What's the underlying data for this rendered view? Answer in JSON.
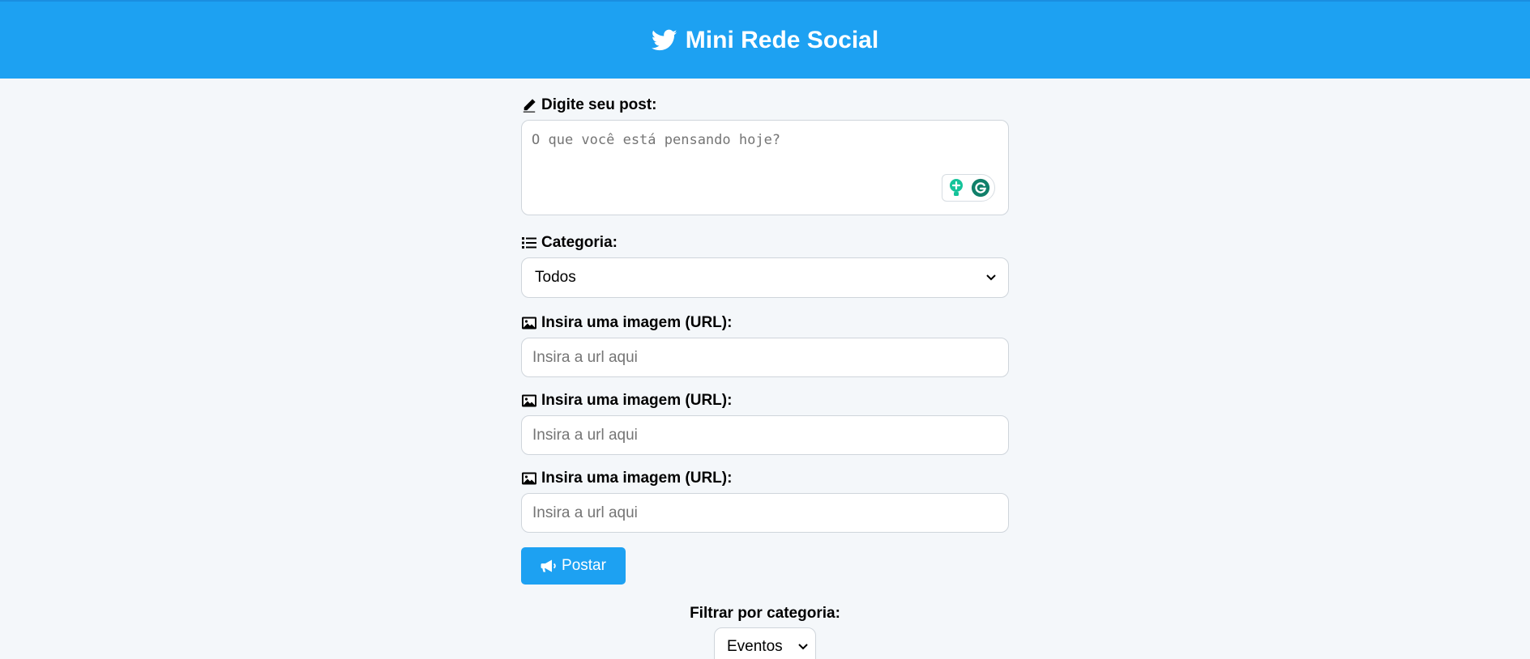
{
  "header": {
    "title": "Mini Rede Social",
    "brand_color": "#1da1f2",
    "icon": "twitter-bird-icon"
  },
  "post_form": {
    "post_label": "Digite seu post:",
    "post_placeholder": "O que você está pensando hoje?",
    "category_label": "Categoria:",
    "category_selected": "Todos",
    "image_fields": [
      {
        "label": "Insira uma imagem (URL):",
        "placeholder": "Insira a url aqui"
      },
      {
        "label": "Insira uma imagem (URL):",
        "placeholder": "Insira a url aqui"
      },
      {
        "label": "Insira uma imagem (URL):",
        "placeholder": "Insira a url aqui"
      }
    ],
    "submit_label": "Postar"
  },
  "filter": {
    "label": "Filtrar por categoria:",
    "selected": "Eventos"
  },
  "colors": {
    "accent": "#1da1f2",
    "background": "#f4f7fa",
    "grammarly": "#15c39a"
  }
}
